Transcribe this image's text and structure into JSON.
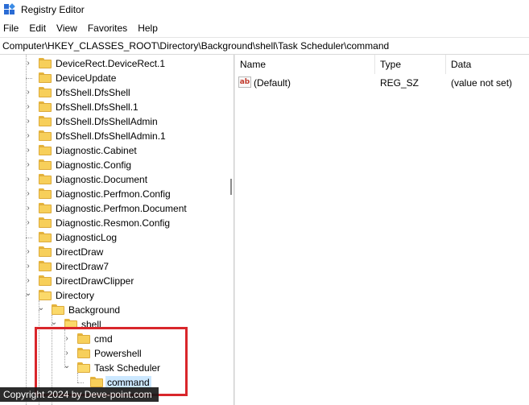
{
  "window": {
    "title": "Registry Editor"
  },
  "menu": [
    "File",
    "Edit",
    "View",
    "Favorites",
    "Help"
  ],
  "address": "Computer\\HKEY_CLASSES_ROOT\\Directory\\Background\\shell\\Task Scheduler\\command",
  "tree": [
    {
      "label": "DeviceRect.DeviceRect.1",
      "level": 0,
      "expander": "collapsed"
    },
    {
      "label": "DeviceUpdate",
      "level": 0,
      "expander": "none"
    },
    {
      "label": "DfsShell.DfsShell",
      "level": 0,
      "expander": "collapsed"
    },
    {
      "label": "DfsShell.DfsShell.1",
      "level": 0,
      "expander": "collapsed"
    },
    {
      "label": "DfsShell.DfsShellAdmin",
      "level": 0,
      "expander": "collapsed"
    },
    {
      "label": "DfsShell.DfsShellAdmin.1",
      "level": 0,
      "expander": "collapsed"
    },
    {
      "label": "Diagnostic.Cabinet",
      "level": 0,
      "expander": "collapsed"
    },
    {
      "label": "Diagnostic.Config",
      "level": 0,
      "expander": "collapsed"
    },
    {
      "label": "Diagnostic.Document",
      "level": 0,
      "expander": "collapsed"
    },
    {
      "label": "Diagnostic.Perfmon.Config",
      "level": 0,
      "expander": "collapsed"
    },
    {
      "label": "Diagnostic.Perfmon.Document",
      "level": 0,
      "expander": "collapsed"
    },
    {
      "label": "Diagnostic.Resmon.Config",
      "level": 0,
      "expander": "collapsed"
    },
    {
      "label": "DiagnosticLog",
      "level": 0,
      "expander": "none"
    },
    {
      "label": "DirectDraw",
      "level": 0,
      "expander": "collapsed"
    },
    {
      "label": "DirectDraw7",
      "level": 0,
      "expander": "collapsed"
    },
    {
      "label": "DirectDrawClipper",
      "level": 0,
      "expander": "collapsed"
    },
    {
      "label": "Directory",
      "level": 0,
      "expander": "expanded"
    },
    {
      "label": "Background",
      "level": 1,
      "expander": "expanded"
    },
    {
      "label": "shell",
      "level": 2,
      "expander": "expanded"
    },
    {
      "label": "cmd",
      "level": 3,
      "expander": "collapsed"
    },
    {
      "label": "Powershell",
      "level": 3,
      "expander": "collapsed"
    },
    {
      "label": "Task Scheduler",
      "level": 3,
      "expander": "expanded"
    },
    {
      "label": "command",
      "level": 4,
      "expander": "none",
      "selected": true
    }
  ],
  "columns": {
    "name": "Name",
    "type": "Type",
    "data": "Data"
  },
  "values": [
    {
      "icon": "ab",
      "name": "(Default)",
      "type": "REG_SZ",
      "data": "(value not set)"
    }
  ],
  "watermark": "Copyright 2024 by Deve-point.com",
  "colors": {
    "highlight_border": "#d9262b",
    "selection": "#cce8ff",
    "folder": "#f7cf5a"
  }
}
